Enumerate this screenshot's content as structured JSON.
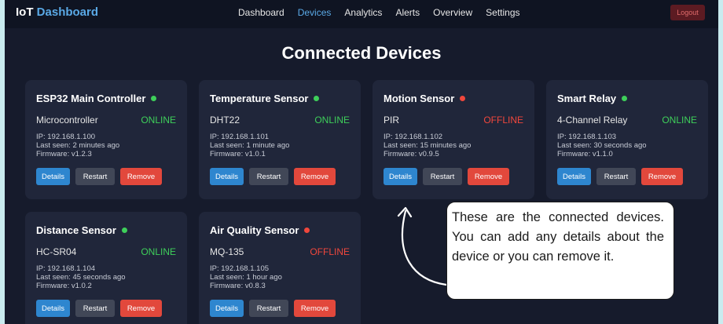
{
  "header": {
    "brand_prefix": "IoT",
    "brand_accent": "Dashboard",
    "nav": [
      "Dashboard",
      "Devices",
      "Analytics",
      "Alerts",
      "Overview",
      "Settings"
    ],
    "active_nav": "Devices",
    "logout_label": "Logout"
  },
  "page_title": "Connected Devices",
  "buttons": {
    "details": "Details",
    "restart": "Restart",
    "remove": "Remove"
  },
  "devices": [
    {
      "name": "ESP32 Main Controller",
      "type": "Microcontroller",
      "status": "ONLINE",
      "ip": "IP: 192.168.1.100",
      "last_seen": "Last seen: 2 minutes ago",
      "firmware": "Firmware: v1.2.3"
    },
    {
      "name": "Temperature Sensor",
      "type": "DHT22",
      "status": "ONLINE",
      "ip": "IP: 192.168.1.101",
      "last_seen": "Last seen: 1 minute ago",
      "firmware": "Firmware: v1.0.1"
    },
    {
      "name": "Motion Sensor",
      "type": "PIR",
      "status": "OFFLINE",
      "ip": "IP: 192.168.1.102",
      "last_seen": "Last seen: 15 minutes ago",
      "firmware": "Firmware: v0.9.5"
    },
    {
      "name": "Smart Relay",
      "type": "4-Channel Relay",
      "status": "ONLINE",
      "ip": "IP: 192.168.1.103",
      "last_seen": "Last seen: 30 seconds ago",
      "firmware": "Firmware: v1.1.0"
    },
    {
      "name": "Distance Sensor",
      "type": "HC-SR04",
      "status": "ONLINE",
      "ip": "IP: 192.168.1.104",
      "last_seen": "Last seen: 45 seconds ago",
      "firmware": "Firmware: v1.0.2"
    },
    {
      "name": "Air Quality Sensor",
      "type": "MQ-135",
      "status": "OFFLINE",
      "ip": "IP: 192.168.1.105",
      "last_seen": "Last seen: 1 hour ago",
      "firmware": "Firmware: v0.8.3"
    }
  ],
  "annotation": {
    "text": "These are the connected devices. You can add any details about the device or you can remove it."
  },
  "colors": {
    "accent": "#5aa9e6",
    "online": "#3ecf5a",
    "offline": "#f0473c",
    "background": "#161b2c",
    "card": "#20263a",
    "frame": "#c9ebef"
  }
}
